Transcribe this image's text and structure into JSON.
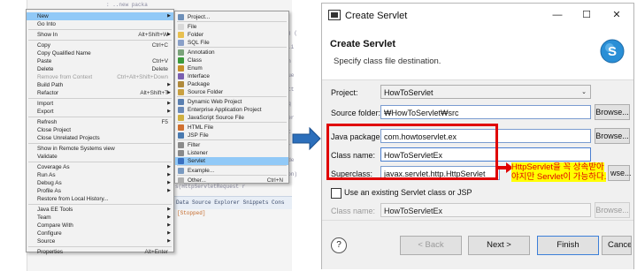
{
  "left_panel": {
    "bg_lines": [
      ": ..new packa",
      "4() (",
      "se.i",
      "ren",
      "eque",
      "nHtt",
      "req",
      "tSer",
      "ipt",
      "Ser",
      "Code",
      "tion)"
    ],
    "bottom_text": "Data Source Explorer   Snippets   Cons",
    "stopped_text": "[Stopped]",
    "side_texts": [
      "s(HttpServletRequest r",
      "tRespon",
      "ad method",
      "dimpl(HttpServletRe",
      "ation.apache.HttpS",
      "WriteBack(request.getParam(\"",
      "ent",
      "p.apache.catalina.Http",
      "sterActionListener(ed"
    ]
  },
  "main_menu": {
    "items": [
      {
        "label": "New",
        "shortcut": "",
        "arrow": true,
        "highlighted": true
      },
      {
        "label": "Go Into",
        "shortcut": ""
      },
      {
        "label": "Show In",
        "shortcut": "Alt+Shift+W",
        "arrow": true
      },
      {
        "label": "Copy",
        "shortcut": "Ctrl+C"
      },
      {
        "label": "Copy Qualified Name",
        "shortcut": ""
      },
      {
        "label": "Paste",
        "shortcut": "Ctrl+V"
      },
      {
        "label": "Delete",
        "shortcut": "Delete"
      },
      {
        "label": "Remove from Context",
        "shortcut": "Ctrl+Alt+Shift+Down",
        "disabled": true
      },
      {
        "label": "Build Path",
        "shortcut": "",
        "arrow": true
      },
      {
        "label": "Refactor",
        "shortcut": "Alt+Shift+T",
        "arrow": true
      },
      {
        "label": "Import",
        "shortcut": "",
        "arrow": true
      },
      {
        "label": "Export",
        "shortcut": "",
        "arrow": true
      },
      {
        "label": "Refresh",
        "shortcut": "F5"
      },
      {
        "label": "Close Project",
        "shortcut": ""
      },
      {
        "label": "Close Unrelated Projects",
        "shortcut": ""
      },
      {
        "label": "Show in Remote Systems view",
        "shortcut": ""
      },
      {
        "label": "Validate",
        "shortcut": ""
      },
      {
        "label": "Coverage As",
        "shortcut": "",
        "arrow": true
      },
      {
        "label": "Run As",
        "shortcut": "",
        "arrow": true
      },
      {
        "label": "Debug As",
        "shortcut": "",
        "arrow": true
      },
      {
        "label": "Profile As",
        "shortcut": "",
        "arrow": true
      },
      {
        "label": "Restore from Local History...",
        "shortcut": ""
      },
      {
        "label": "Java EE Tools",
        "shortcut": "",
        "arrow": true
      },
      {
        "label": "Team",
        "shortcut": "",
        "arrow": true
      },
      {
        "label": "Compare With",
        "shortcut": "",
        "arrow": true
      },
      {
        "label": "Configure",
        "shortcut": "",
        "arrow": true
      },
      {
        "label": "Source",
        "shortcut": "",
        "arrow": true
      },
      {
        "label": "Properties",
        "shortcut": "Alt+Enter"
      }
    ]
  },
  "sub_menu": {
    "items": [
      {
        "label": "Project...",
        "icon_color": "#6d8fb8"
      },
      {
        "label": "File",
        "icon_color": "#d9d9d9"
      },
      {
        "label": "Folder",
        "icon_color": "#e8c050"
      },
      {
        "label": "SQL File",
        "icon_color": "#8aa0c8"
      },
      {
        "label": "Annotation",
        "icon_color": "#7aa37a"
      },
      {
        "label": "Class",
        "icon_color": "#3c9a3c"
      },
      {
        "label": "Enum",
        "icon_color": "#c8902a"
      },
      {
        "label": "Interface",
        "icon_color": "#7a5fb0"
      },
      {
        "label": "Package",
        "icon_color": "#b08a3c"
      },
      {
        "label": "Source Folder",
        "icon_color": "#c9a040"
      },
      {
        "label": "Dynamic Web Project",
        "icon_color": "#5a7fb0"
      },
      {
        "label": "Enterprise Application Project",
        "icon_color": "#6a8ab8"
      },
      {
        "label": "JavaScript Source File",
        "icon_color": "#d0b040"
      },
      {
        "label": "HTML File",
        "icon_color": "#d07030"
      },
      {
        "label": "JSP File",
        "icon_color": "#4a7ab0"
      },
      {
        "label": "Filter",
        "icon_color": "#8a8a8a"
      },
      {
        "label": "Listener",
        "icon_color": "#8a8a8a"
      },
      {
        "label": "Servlet",
        "icon_color": "#3a70c0",
        "highlighted": true
      },
      {
        "label": "Example...",
        "icon_color": "#7a9ac0"
      },
      {
        "label": "Other...",
        "icon_color": "#b0b0b0",
        "shortcut": "Ctrl+N"
      }
    ]
  },
  "dialog": {
    "window_title": "Create Servlet",
    "header_title": "Create Servlet",
    "header_subtitle": "Specify class file destination.",
    "project_label": "Project:",
    "project_value": "HowToServlet",
    "source_folder_label": "Source folder:",
    "source_folder_value": "₩HowToServlet₩src",
    "java_package_label": "Java package:",
    "java_package_value": "com.howtoservlet.ex",
    "class_name_label": "Class name:",
    "class_name_value": "HowToServletEx",
    "superclass_label": "Superclass:",
    "superclass_value": "javax.servlet.http.HttpServlet",
    "use_existing_label": "Use an existing Servlet class or JSP",
    "class_name2_label": "Class name:",
    "class_name2_value": "HowToServletEx",
    "browse_label": "Browse...",
    "browse_short": "wse...",
    "back_label": "< Back",
    "next_label": "Next >",
    "finish_label": "Finish",
    "cancel_label": "Cancel",
    "help_glyph": "?"
  },
  "annotation": {
    "note_text": "HttpServlet을 꼭 상속받아야지만 Servlet이 가능하다."
  },
  "colors": {
    "highlight": "#91c9f7",
    "annotation_red": "#e00000",
    "annotation_yellow": "#ffff00",
    "arrow_blue": "#2c6fbb"
  }
}
